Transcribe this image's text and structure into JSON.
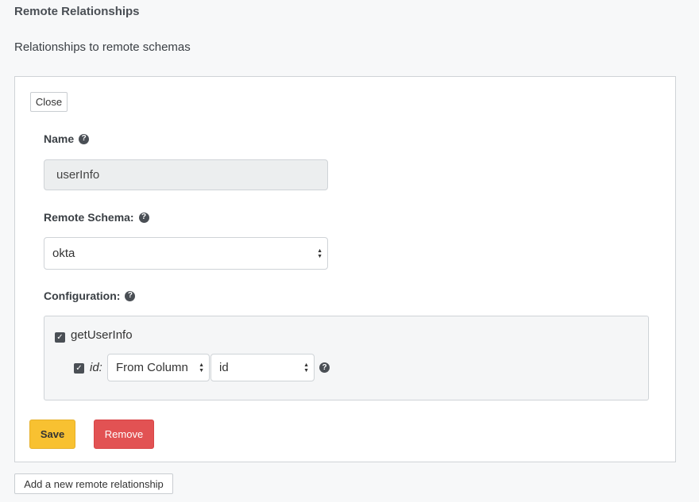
{
  "page": {
    "title": "Remote Relationships",
    "subtitle": "Relationships to remote schemas",
    "add_button_label": "Add a new remote relationship"
  },
  "editor": {
    "close_label": "Close",
    "name_label": "Name",
    "name_value": "userInfo",
    "remote_schema_label": "Remote Schema:",
    "remote_schema_value": "okta",
    "configuration_label": "Configuration:",
    "field": {
      "name": "getUserInfo",
      "checked": true,
      "argument": {
        "name": "id:",
        "checked": true,
        "source_type": "From Column",
        "column": "id"
      }
    },
    "save_label": "Save",
    "remove_label": "Remove"
  },
  "icons": {
    "help": "question-circle-icon",
    "checkbox": "checkbox-checked-icon",
    "select_arrows": "sort-arrows-icon"
  },
  "colors": {
    "save_button": "#f8c131",
    "remove_button": "#e25253",
    "page_background": "#f7f8f9",
    "readonly_input": "#eceeef"
  }
}
